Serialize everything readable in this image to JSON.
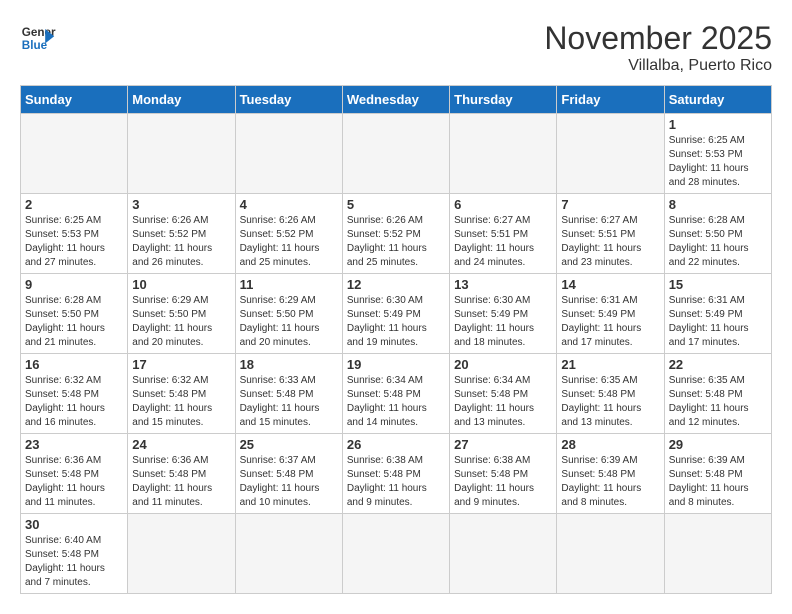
{
  "header": {
    "logo_general": "General",
    "logo_blue": "Blue",
    "month_title": "November 2025",
    "location": "Villalba, Puerto Rico"
  },
  "days_of_week": [
    "Sunday",
    "Monday",
    "Tuesday",
    "Wednesday",
    "Thursday",
    "Friday",
    "Saturday"
  ],
  "weeks": [
    [
      {
        "day": "",
        "info": ""
      },
      {
        "day": "",
        "info": ""
      },
      {
        "day": "",
        "info": ""
      },
      {
        "day": "",
        "info": ""
      },
      {
        "day": "",
        "info": ""
      },
      {
        "day": "",
        "info": ""
      },
      {
        "day": "1",
        "info": "Sunrise: 6:25 AM\nSunset: 5:53 PM\nDaylight: 11 hours\nand 28 minutes."
      }
    ],
    [
      {
        "day": "2",
        "info": "Sunrise: 6:25 AM\nSunset: 5:53 PM\nDaylight: 11 hours\nand 27 minutes."
      },
      {
        "day": "3",
        "info": "Sunrise: 6:26 AM\nSunset: 5:52 PM\nDaylight: 11 hours\nand 26 minutes."
      },
      {
        "day": "4",
        "info": "Sunrise: 6:26 AM\nSunset: 5:52 PM\nDaylight: 11 hours\nand 25 minutes."
      },
      {
        "day": "5",
        "info": "Sunrise: 6:26 AM\nSunset: 5:52 PM\nDaylight: 11 hours\nand 25 minutes."
      },
      {
        "day": "6",
        "info": "Sunrise: 6:27 AM\nSunset: 5:51 PM\nDaylight: 11 hours\nand 24 minutes."
      },
      {
        "day": "7",
        "info": "Sunrise: 6:27 AM\nSunset: 5:51 PM\nDaylight: 11 hours\nand 23 minutes."
      },
      {
        "day": "8",
        "info": "Sunrise: 6:28 AM\nSunset: 5:50 PM\nDaylight: 11 hours\nand 22 minutes."
      }
    ],
    [
      {
        "day": "9",
        "info": "Sunrise: 6:28 AM\nSunset: 5:50 PM\nDaylight: 11 hours\nand 21 minutes."
      },
      {
        "day": "10",
        "info": "Sunrise: 6:29 AM\nSunset: 5:50 PM\nDaylight: 11 hours\nand 20 minutes."
      },
      {
        "day": "11",
        "info": "Sunrise: 6:29 AM\nSunset: 5:50 PM\nDaylight: 11 hours\nand 20 minutes."
      },
      {
        "day": "12",
        "info": "Sunrise: 6:30 AM\nSunset: 5:49 PM\nDaylight: 11 hours\nand 19 minutes."
      },
      {
        "day": "13",
        "info": "Sunrise: 6:30 AM\nSunset: 5:49 PM\nDaylight: 11 hours\nand 18 minutes."
      },
      {
        "day": "14",
        "info": "Sunrise: 6:31 AM\nSunset: 5:49 PM\nDaylight: 11 hours\nand 17 minutes."
      },
      {
        "day": "15",
        "info": "Sunrise: 6:31 AM\nSunset: 5:49 PM\nDaylight: 11 hours\nand 17 minutes."
      }
    ],
    [
      {
        "day": "16",
        "info": "Sunrise: 6:32 AM\nSunset: 5:48 PM\nDaylight: 11 hours\nand 16 minutes."
      },
      {
        "day": "17",
        "info": "Sunrise: 6:32 AM\nSunset: 5:48 PM\nDaylight: 11 hours\nand 15 minutes."
      },
      {
        "day": "18",
        "info": "Sunrise: 6:33 AM\nSunset: 5:48 PM\nDaylight: 11 hours\nand 15 minutes."
      },
      {
        "day": "19",
        "info": "Sunrise: 6:34 AM\nSunset: 5:48 PM\nDaylight: 11 hours\nand 14 minutes."
      },
      {
        "day": "20",
        "info": "Sunrise: 6:34 AM\nSunset: 5:48 PM\nDaylight: 11 hours\nand 13 minutes."
      },
      {
        "day": "21",
        "info": "Sunrise: 6:35 AM\nSunset: 5:48 PM\nDaylight: 11 hours\nand 13 minutes."
      },
      {
        "day": "22",
        "info": "Sunrise: 6:35 AM\nSunset: 5:48 PM\nDaylight: 11 hours\nand 12 minutes."
      }
    ],
    [
      {
        "day": "23",
        "info": "Sunrise: 6:36 AM\nSunset: 5:48 PM\nDaylight: 11 hours\nand 11 minutes."
      },
      {
        "day": "24",
        "info": "Sunrise: 6:36 AM\nSunset: 5:48 PM\nDaylight: 11 hours\nand 11 minutes."
      },
      {
        "day": "25",
        "info": "Sunrise: 6:37 AM\nSunset: 5:48 PM\nDaylight: 11 hours\nand 10 minutes."
      },
      {
        "day": "26",
        "info": "Sunrise: 6:38 AM\nSunset: 5:48 PM\nDaylight: 11 hours\nand 9 minutes."
      },
      {
        "day": "27",
        "info": "Sunrise: 6:38 AM\nSunset: 5:48 PM\nDaylight: 11 hours\nand 9 minutes."
      },
      {
        "day": "28",
        "info": "Sunrise: 6:39 AM\nSunset: 5:48 PM\nDaylight: 11 hours\nand 8 minutes."
      },
      {
        "day": "29",
        "info": "Sunrise: 6:39 AM\nSunset: 5:48 PM\nDaylight: 11 hours\nand 8 minutes."
      }
    ],
    [
      {
        "day": "30",
        "info": "Sunrise: 6:40 AM\nSunset: 5:48 PM\nDaylight: 11 hours\nand 7 minutes."
      },
      {
        "day": "",
        "info": ""
      },
      {
        "day": "",
        "info": ""
      },
      {
        "day": "",
        "info": ""
      },
      {
        "day": "",
        "info": ""
      },
      {
        "day": "",
        "info": ""
      },
      {
        "day": "",
        "info": ""
      }
    ]
  ]
}
